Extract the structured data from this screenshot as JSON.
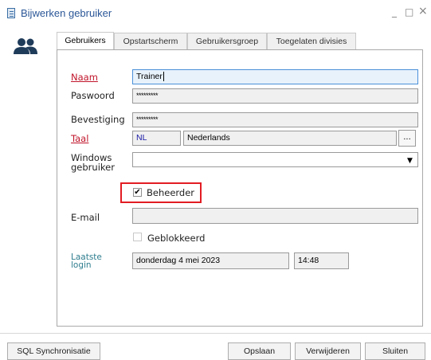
{
  "window": {
    "title": "Bijwerken gebruiker",
    "minimize_glyph": "_",
    "maximize_glyph": "□",
    "close_glyph": "×"
  },
  "tabs": [
    {
      "label": "Gebruikers",
      "active": true
    },
    {
      "label": "Opstartscherm",
      "active": false
    },
    {
      "label": "Gebruikersgroep",
      "active": false
    },
    {
      "label": "Toegelaten divisies",
      "active": false
    }
  ],
  "form": {
    "name_label": "Naam",
    "name_value": "Trainer",
    "password_label": "Paswoord",
    "password_value": "*********",
    "confirm_label": "Bevestiging",
    "confirm_value": "*********",
    "language_label": "Taal",
    "language_code": "NL",
    "language_name": "Nederlands",
    "language_picker_label": "...",
    "windows_user_label_line1": "Windows",
    "windows_user_label_line2": "gebruiker",
    "windows_user_value": "",
    "admin_label": "Beheerder",
    "admin_checked": true,
    "email_label": "E-mail",
    "email_value": "",
    "blocked_label": "Geblokkeerd",
    "blocked_checked": false,
    "last_login_label_line1": "Laatste",
    "last_login_label_line2": "login",
    "last_login_date": "donderdag 4 mei 2023",
    "last_login_time": "14:48",
    "check_glyph": "✔"
  },
  "footer": {
    "sql_sync_label": "SQL Synchronisatie",
    "save_label": "Opslaan",
    "delete_label": "Verwijderen",
    "close_label": "Sluiten"
  },
  "colors": {
    "title": "#2b5797",
    "required_label": "#c0142a",
    "highlight": "#e21c23",
    "focus_border": "#4a90d9"
  }
}
